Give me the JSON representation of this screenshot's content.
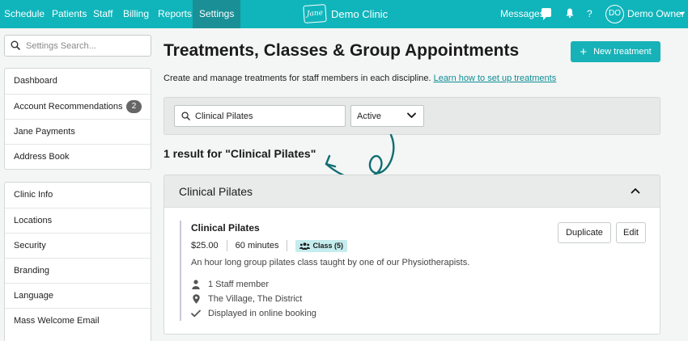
{
  "nav": {
    "items": [
      {
        "label": "Schedule"
      },
      {
        "label": "Patients"
      },
      {
        "label": "Staff"
      },
      {
        "label": "Billing"
      },
      {
        "label": "Reports"
      },
      {
        "label": "Settings",
        "active": true
      }
    ],
    "logo_text": "Jane",
    "clinic_name": "Demo Clinic",
    "messages_label": "Messages",
    "help_label": "?",
    "avatar_initials": "DO",
    "user_name": "Demo Owner",
    "accent_color": "#0fb5bb",
    "active_tab_color": "#1a8f96"
  },
  "sidebar": {
    "search_placeholder": "Settings Search...",
    "group1": [
      {
        "label": "Dashboard"
      },
      {
        "label": "Account Recommendations",
        "badge": "2"
      },
      {
        "label": "Jane Payments"
      },
      {
        "label": "Address Book"
      }
    ],
    "group2": [
      {
        "label": "Clinic Info"
      },
      {
        "label": "Locations"
      },
      {
        "label": "Security"
      },
      {
        "label": "Branding"
      },
      {
        "label": "Language"
      },
      {
        "label": "Mass Welcome Email"
      }
    ]
  },
  "main": {
    "title": "Treatments, Classes & Group Appointments",
    "new_button_label": "New treatment",
    "subtitle": "Create and manage treatments for staff members in each discipline.",
    "learn_link": "Learn how to set up treatments",
    "filter": {
      "search_value": "Clinical Pilates",
      "status_value": "Active"
    },
    "result_count": "1 result for \"Clinical Pilates\"",
    "group": {
      "title": "Clinical Pilates",
      "treatment": {
        "name": "Clinical Pilates",
        "price": "$25.00",
        "duration": "60 minutes",
        "type_badge": "Class (5)",
        "description": "An hour long group pilates class taught by one of our Physiotherapists.",
        "staff": "1 Staff member",
        "locations": "The Village, The District",
        "online": "Displayed in online booking",
        "duplicate_label": "Duplicate",
        "edit_label": "Edit"
      }
    }
  }
}
